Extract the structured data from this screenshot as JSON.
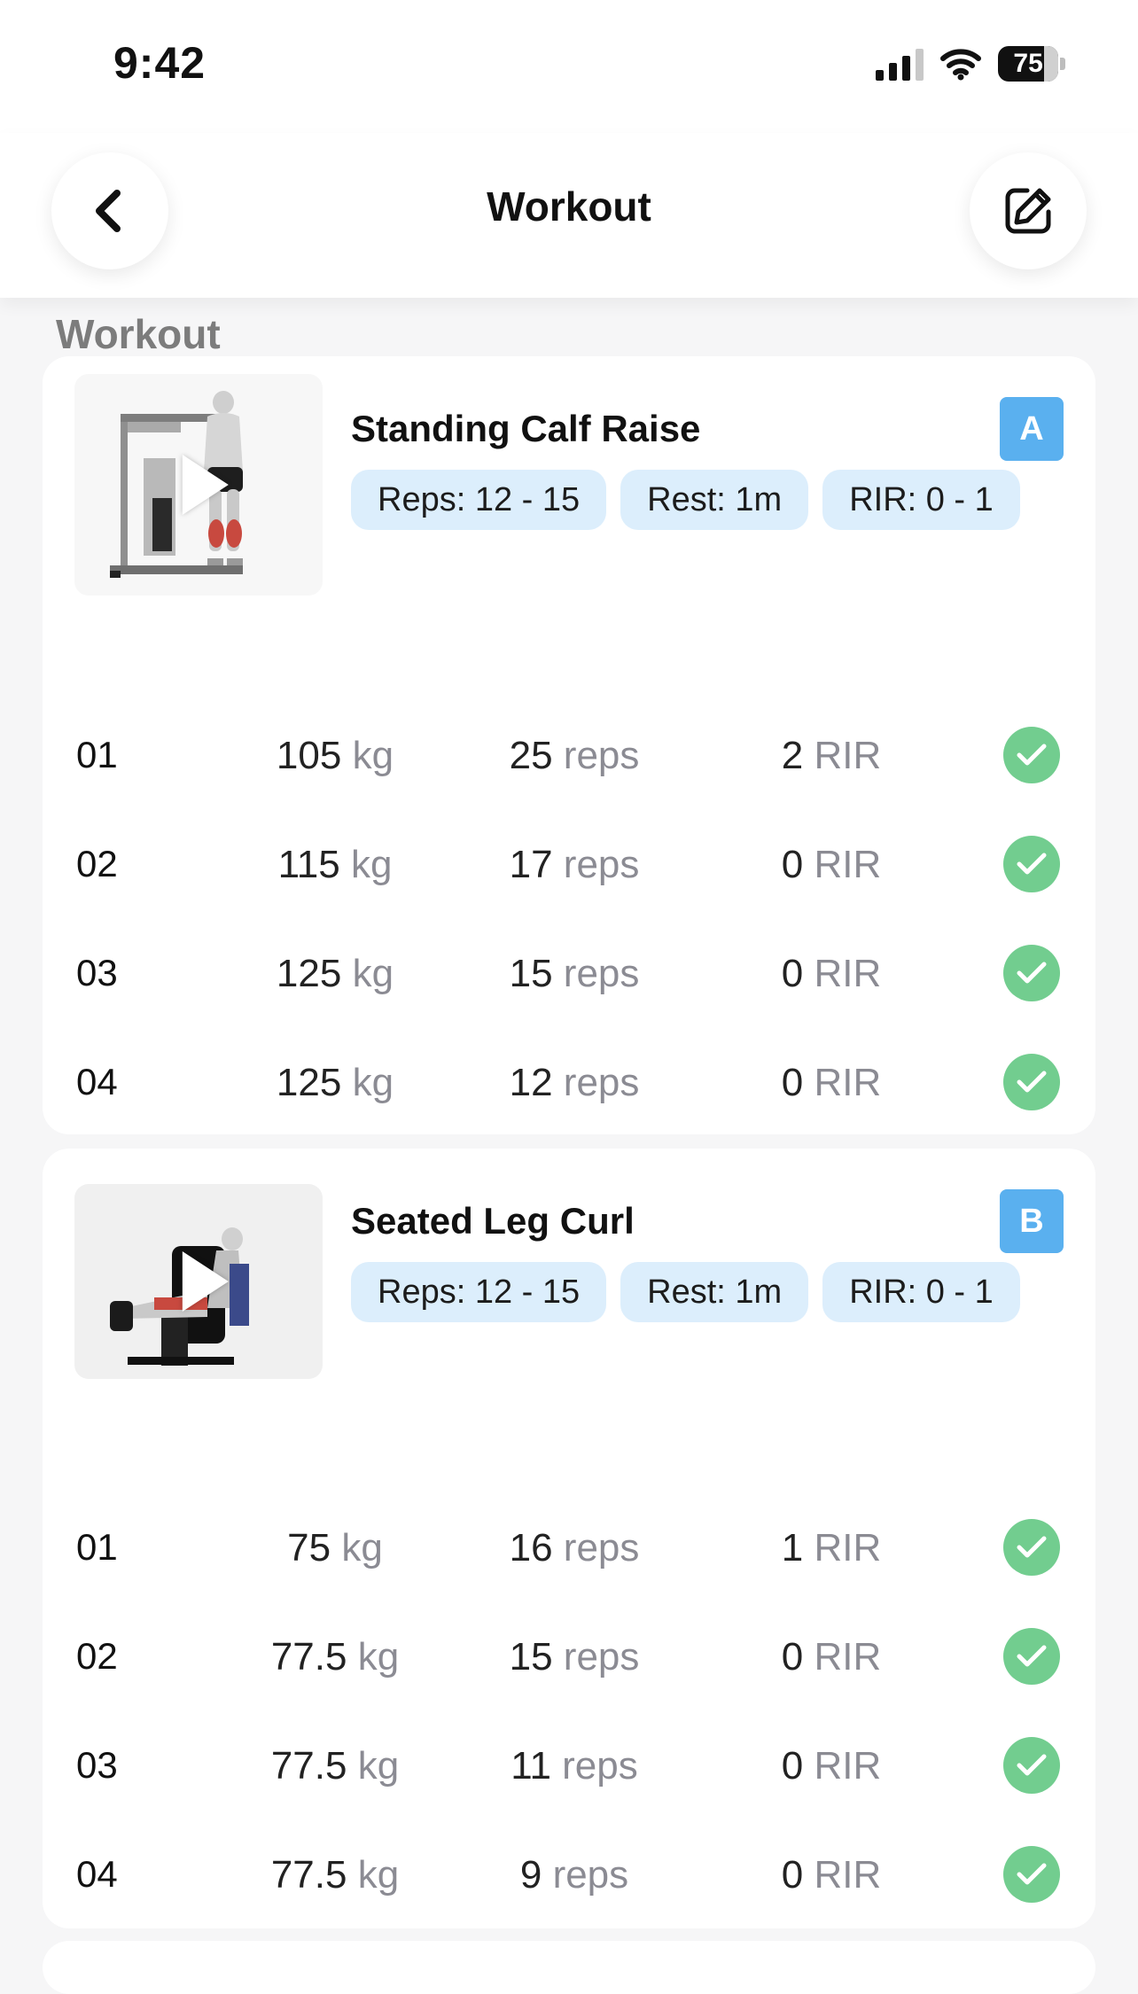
{
  "status_bar": {
    "time": "9:42",
    "battery": "75",
    "icons": [
      "cellular-signal-icon",
      "wifi-icon",
      "battery-icon"
    ]
  },
  "header": {
    "title": "Workout",
    "back_icon": "chevron-left-icon",
    "edit_icon": "edit-square-icon"
  },
  "section_title": "Workout",
  "colors": {
    "accent": "#5ab0ef",
    "tag_bg": "#dceefc",
    "check": "#72cd8f",
    "unit_text": "#8b8b93"
  },
  "exercises": [
    {
      "name": "Standing Calf Raise",
      "badge": "A",
      "tags": [
        "Reps: 12 - 15",
        "Rest: 1m",
        "RIR: 0 - 1"
      ],
      "sets": [
        {
          "num": "01",
          "weight": "105",
          "weight_unit": "kg",
          "reps": "25",
          "reps_unit": "reps",
          "rir": "2",
          "rir_unit": "RIR"
        },
        {
          "num": "02",
          "weight": "115",
          "weight_unit": "kg",
          "reps": "17",
          "reps_unit": "reps",
          "rir": "0",
          "rir_unit": "RIR"
        },
        {
          "num": "03",
          "weight": "125",
          "weight_unit": "kg",
          "reps": "15",
          "reps_unit": "reps",
          "rir": "0",
          "rir_unit": "RIR"
        },
        {
          "num": "04",
          "weight": "125",
          "weight_unit": "kg",
          "reps": "12",
          "reps_unit": "reps",
          "rir": "0",
          "rir_unit": "RIR"
        }
      ]
    },
    {
      "name": "Seated Leg Curl",
      "badge": "B",
      "tags": [
        "Reps: 12 - 15",
        "Rest: 1m",
        "RIR: 0 - 1"
      ],
      "sets": [
        {
          "num": "01",
          "weight": "75",
          "weight_unit": "kg",
          "reps": "16",
          "reps_unit": "reps",
          "rir": "1",
          "rir_unit": "RIR"
        },
        {
          "num": "02",
          "weight": "77.5",
          "weight_unit": "kg",
          "reps": "15",
          "reps_unit": "reps",
          "rir": "0",
          "rir_unit": "RIR"
        },
        {
          "num": "03",
          "weight": "77.5",
          "weight_unit": "kg",
          "reps": "11",
          "reps_unit": "reps",
          "rir": "0",
          "rir_unit": "RIR"
        },
        {
          "num": "04",
          "weight": "77.5",
          "weight_unit": "kg",
          "reps": "9",
          "reps_unit": "reps",
          "rir": "0",
          "rir_unit": "RIR"
        }
      ]
    }
  ]
}
